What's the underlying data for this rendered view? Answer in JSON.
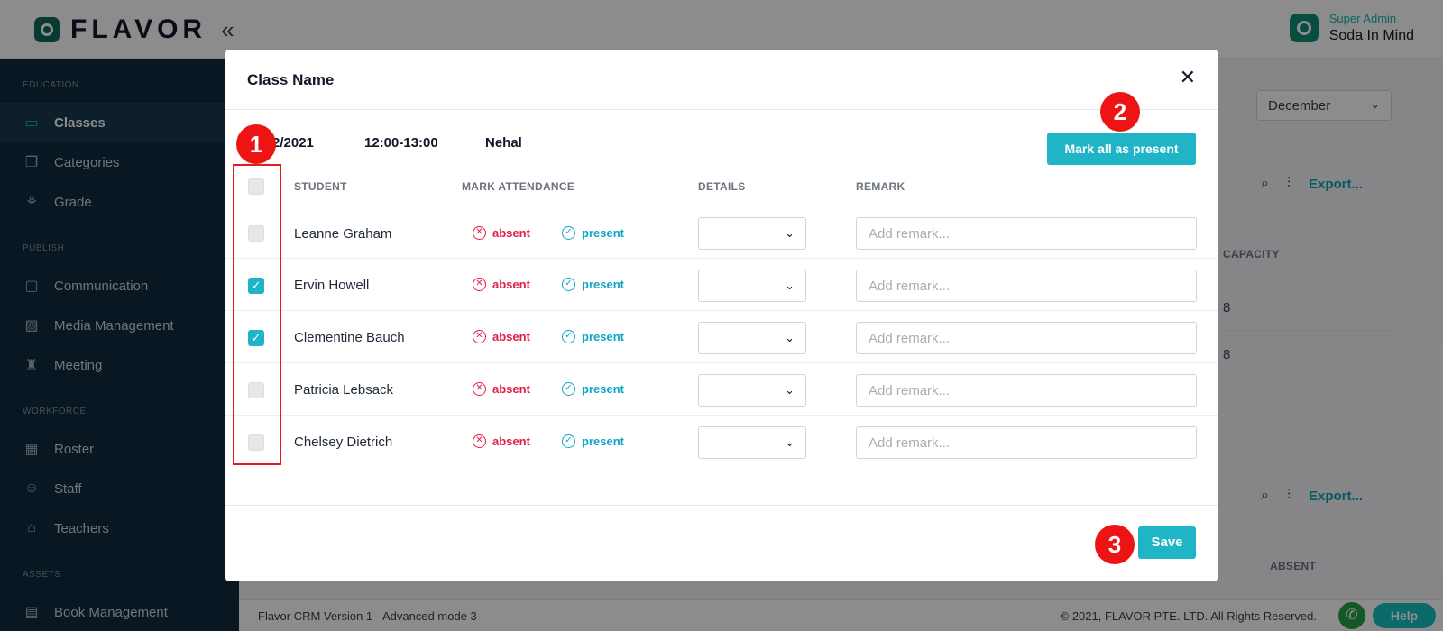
{
  "app": {
    "logo_text": "FLAVOR",
    "user_role": "Super Admin",
    "user_name": "Soda In Mind"
  },
  "sidebar": {
    "sections": [
      {
        "title": "EDUCATION",
        "items": [
          {
            "label": "Classes",
            "icon": "book-icon",
            "active": true
          },
          {
            "label": "Categories",
            "icon": "layers-icon"
          },
          {
            "label": "Grade",
            "icon": "grade-icon"
          }
        ]
      },
      {
        "title": "PUBLISH",
        "items": [
          {
            "label": "Communication",
            "icon": "chat-icon"
          },
          {
            "label": "Media Management",
            "icon": "image-icon"
          },
          {
            "label": "Meeting",
            "icon": "meeting-icon"
          }
        ]
      },
      {
        "title": "WORKFORCE",
        "items": [
          {
            "label": "Roster",
            "icon": "calendar-icon"
          },
          {
            "label": "Staff",
            "icon": "people-icon"
          },
          {
            "label": "Teachers",
            "icon": "graduation-icon"
          }
        ]
      },
      {
        "title": "ASSETS",
        "items": [
          {
            "label": "Book Management",
            "icon": "book-stack-icon"
          }
        ]
      }
    ]
  },
  "background": {
    "month": "December",
    "export_label": "Export...",
    "col_capacity": "CAPACITY",
    "col_absent": "ABSENT",
    "capacity_values": [
      "8",
      "8"
    ]
  },
  "footer": {
    "version": "Flavor CRM Version 1 - Advanced mode 3",
    "copyright": "© 2021, FLAVOR PTE. LTD. All Rights Reserved.",
    "help": "Help"
  },
  "modal": {
    "title": "Class Name",
    "date": "2/2021",
    "time": "12:00-13:00",
    "teacher": "Nehal",
    "mark_all_label": "Mark all as present",
    "headers": {
      "student": "STUDENT",
      "mark": "MARK ATTENDANCE",
      "details": "DETAILS",
      "remark": "REMARK"
    },
    "absent_label": "absent",
    "present_label": "present",
    "remark_placeholder": "Add remark...",
    "students": [
      {
        "name": "Leanne Graham",
        "checked": false
      },
      {
        "name": "Ervin Howell",
        "checked": true
      },
      {
        "name": "Clementine Bauch",
        "checked": true
      },
      {
        "name": "Patricia Lebsack",
        "checked": false
      },
      {
        "name": "Chelsey Dietrich",
        "checked": false
      }
    ],
    "save_label": "Save"
  },
  "annotations": {
    "badge_1": "1",
    "badge_2": "2",
    "badge_3": "3"
  },
  "colors": {
    "accent": "#1fb5c7",
    "absent": "#e11d48",
    "sidebar": "#0f2a3c",
    "annotation": "#ef1414"
  }
}
